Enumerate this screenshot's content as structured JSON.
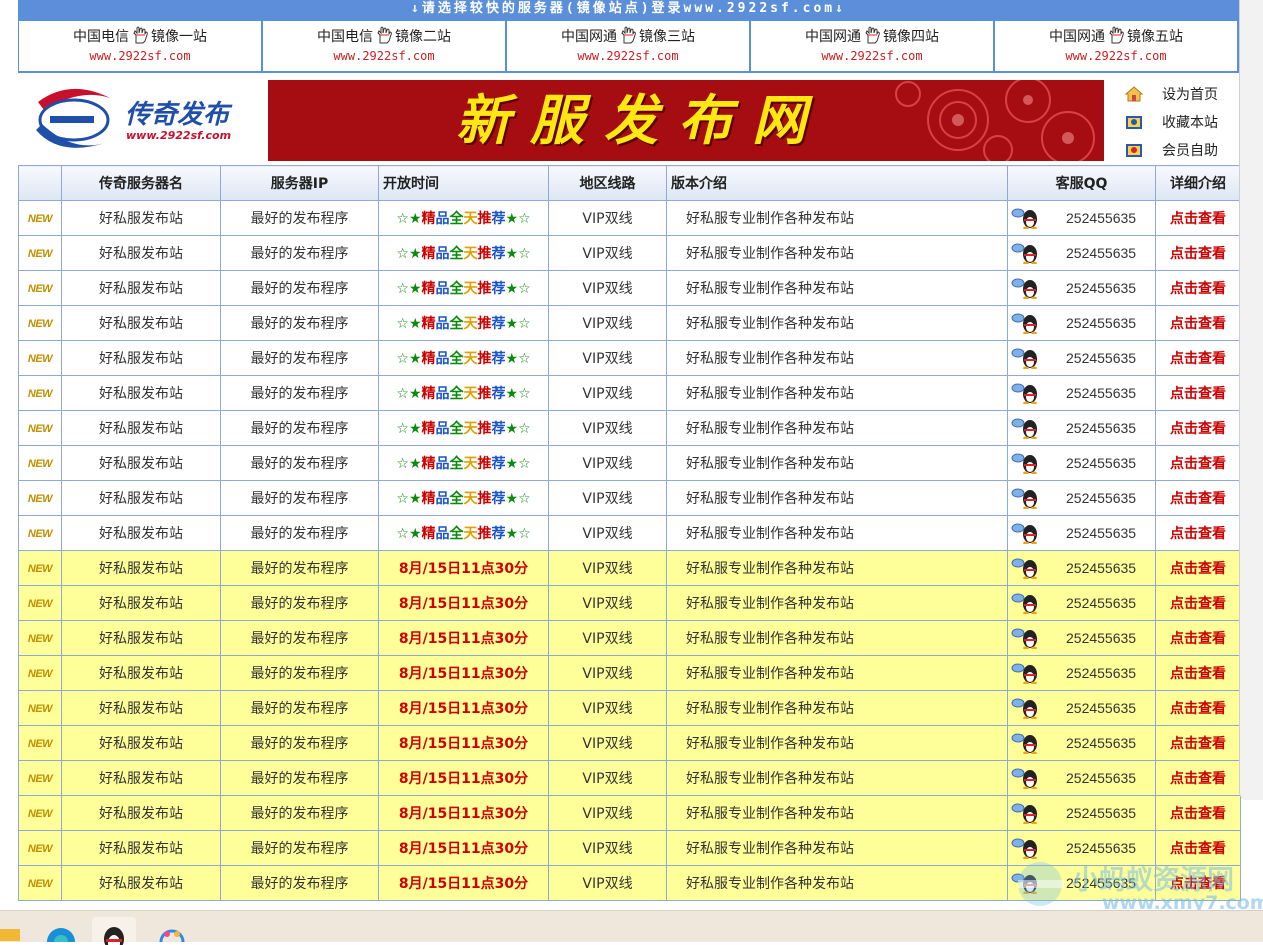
{
  "topbar": {
    "text": "↓请选择较快的服务器(镜像站点)登录www.2922sf.com↓"
  },
  "mirrors": [
    {
      "name_before": "中国电信",
      "name_after": "镜像一站",
      "url": "www.2922sf.com"
    },
    {
      "name_before": "中国电信",
      "name_after": "镜像二站",
      "url": "www.2922sf.com"
    },
    {
      "name_before": "中国网通",
      "name_after": "镜像三站",
      "url": "www.2922sf.com"
    },
    {
      "name_before": "中国网通",
      "name_after": "镜像四站",
      "url": "www.2922sf.com"
    },
    {
      "name_before": "中国网通",
      "name_after": "镜像五站",
      "url": "www.2922sf.com"
    }
  ],
  "logo": {
    "title": "传奇发布",
    "url": "www.2922sf.com"
  },
  "banner": {
    "title": "新服发布网"
  },
  "sidelinks": [
    {
      "label": "设为首页",
      "icon": "home-icon"
    },
    {
      "label": "收藏本站",
      "icon": "bookmark-icon"
    },
    {
      "label": "会员自助",
      "icon": "member-icon"
    }
  ],
  "table": {
    "headers": [
      "",
      "传奇服务器名",
      "服务器IP",
      "开放时间",
      "地区线路",
      "版本介绍",
      "客服QQ",
      "详细介绍"
    ],
    "badge": "NEW",
    "row_common": {
      "name": "好私服发布站",
      "ip": "最好的发布程序",
      "line": "VIP双线",
      "intro": "好私服专业制作各种发布站",
      "qq": "252455635",
      "detail": "点击查看"
    },
    "recommend_parts": [
      "☆",
      "★",
      "精",
      "品",
      "全",
      "天",
      "推",
      "荐",
      "★",
      "☆"
    ],
    "recommend_colors": [
      "#0a8a0a",
      "#0a8a0a",
      "#cc0000",
      "#1a55cc",
      "#0a8a0a",
      "#e0a000",
      "#cc0000",
      "#1a55cc",
      "#0a8a0a",
      "#0a8a0a"
    ],
    "time_text": "8月/15日11点30分",
    "white_rows": 10,
    "yellow_rows": 10
  },
  "watermark": {
    "line1": "小蚂蚁资源网",
    "line2": "www.xmy7.com"
  }
}
